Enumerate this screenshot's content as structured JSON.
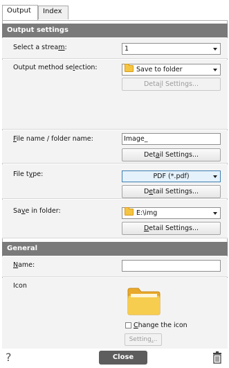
{
  "tabs": [
    {
      "label": "Output",
      "active": true
    },
    {
      "label": "Index",
      "active": false
    }
  ],
  "sections": {
    "output_settings": "Output settings",
    "general": "General"
  },
  "stream": {
    "label_pre": "Select a strea",
    "label_u": "m",
    "label_post": ":",
    "value": "1"
  },
  "output_method": {
    "label_pre": "Output method se",
    "label_u": "l",
    "label_post": "ection:",
    "value": "Save to folder",
    "button_pre": "Deta",
    "button_u": "i",
    "button_post": "l Settings..."
  },
  "file_name": {
    "label_u": "F",
    "label_post": "ile name / folder name:",
    "value": "Image_",
    "button_pre": "Det",
    "button_u": "a",
    "button_post": "il Settings..."
  },
  "file_type": {
    "label_pre": "File t",
    "label_u": "y",
    "label_post": "pe:",
    "value": "PDF (*.pdf)",
    "button_pre": "D",
    "button_u": "e",
    "button_post": "tail Settings..."
  },
  "save_folder": {
    "label_pre": "Sa",
    "label_u": "v",
    "label_post": "e in folder:",
    "value": "E:\\img",
    "button_pre": "",
    "button_u": "D",
    "button_post": "etail Settings..."
  },
  "name": {
    "label_u": "N",
    "label_post": "ame:",
    "value": ""
  },
  "icon": {
    "label": "Icon",
    "change_pre": "",
    "change_u": "C",
    "change_post": "hange the icon",
    "change_checked": false,
    "setting_pre": "Setting",
    "setting_u": ".",
    "setting_post": ".."
  },
  "footer": {
    "help": "?",
    "close": "Close"
  },
  "colors": {
    "section_bg": "#7a7a7a",
    "row_bg": "#f3f3f3",
    "close_bg": "#5d5d5d",
    "folder": "#f5c542"
  }
}
